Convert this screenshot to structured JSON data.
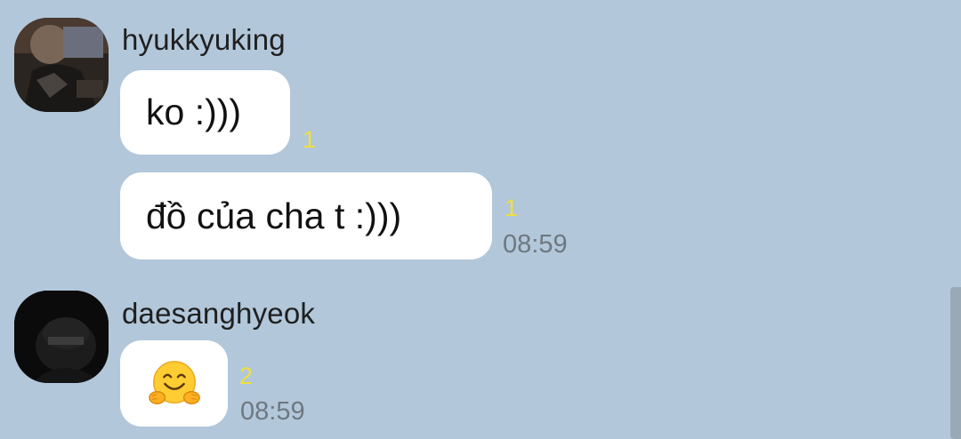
{
  "messages": [
    {
      "sender": "hyukkyuking",
      "avatar_icon": "avatar-icon",
      "bubbles": [
        {
          "text": "ko :)))",
          "read_count": "1"
        },
        {
          "text": "đồ của cha t :)))",
          "read_count": "1",
          "time": "08:59"
        }
      ]
    },
    {
      "sender": "daesanghyeok",
      "avatar_icon": "avatar-icon",
      "bubbles": [
        {
          "emoji": "hugging-face-emoji",
          "read_count": "2",
          "time": "08:59"
        }
      ]
    }
  ],
  "colors": {
    "chat_background": "#b2c7da",
    "bubble": "#ffffff",
    "read_count": "#f0df3c",
    "time": "#6e7880"
  }
}
